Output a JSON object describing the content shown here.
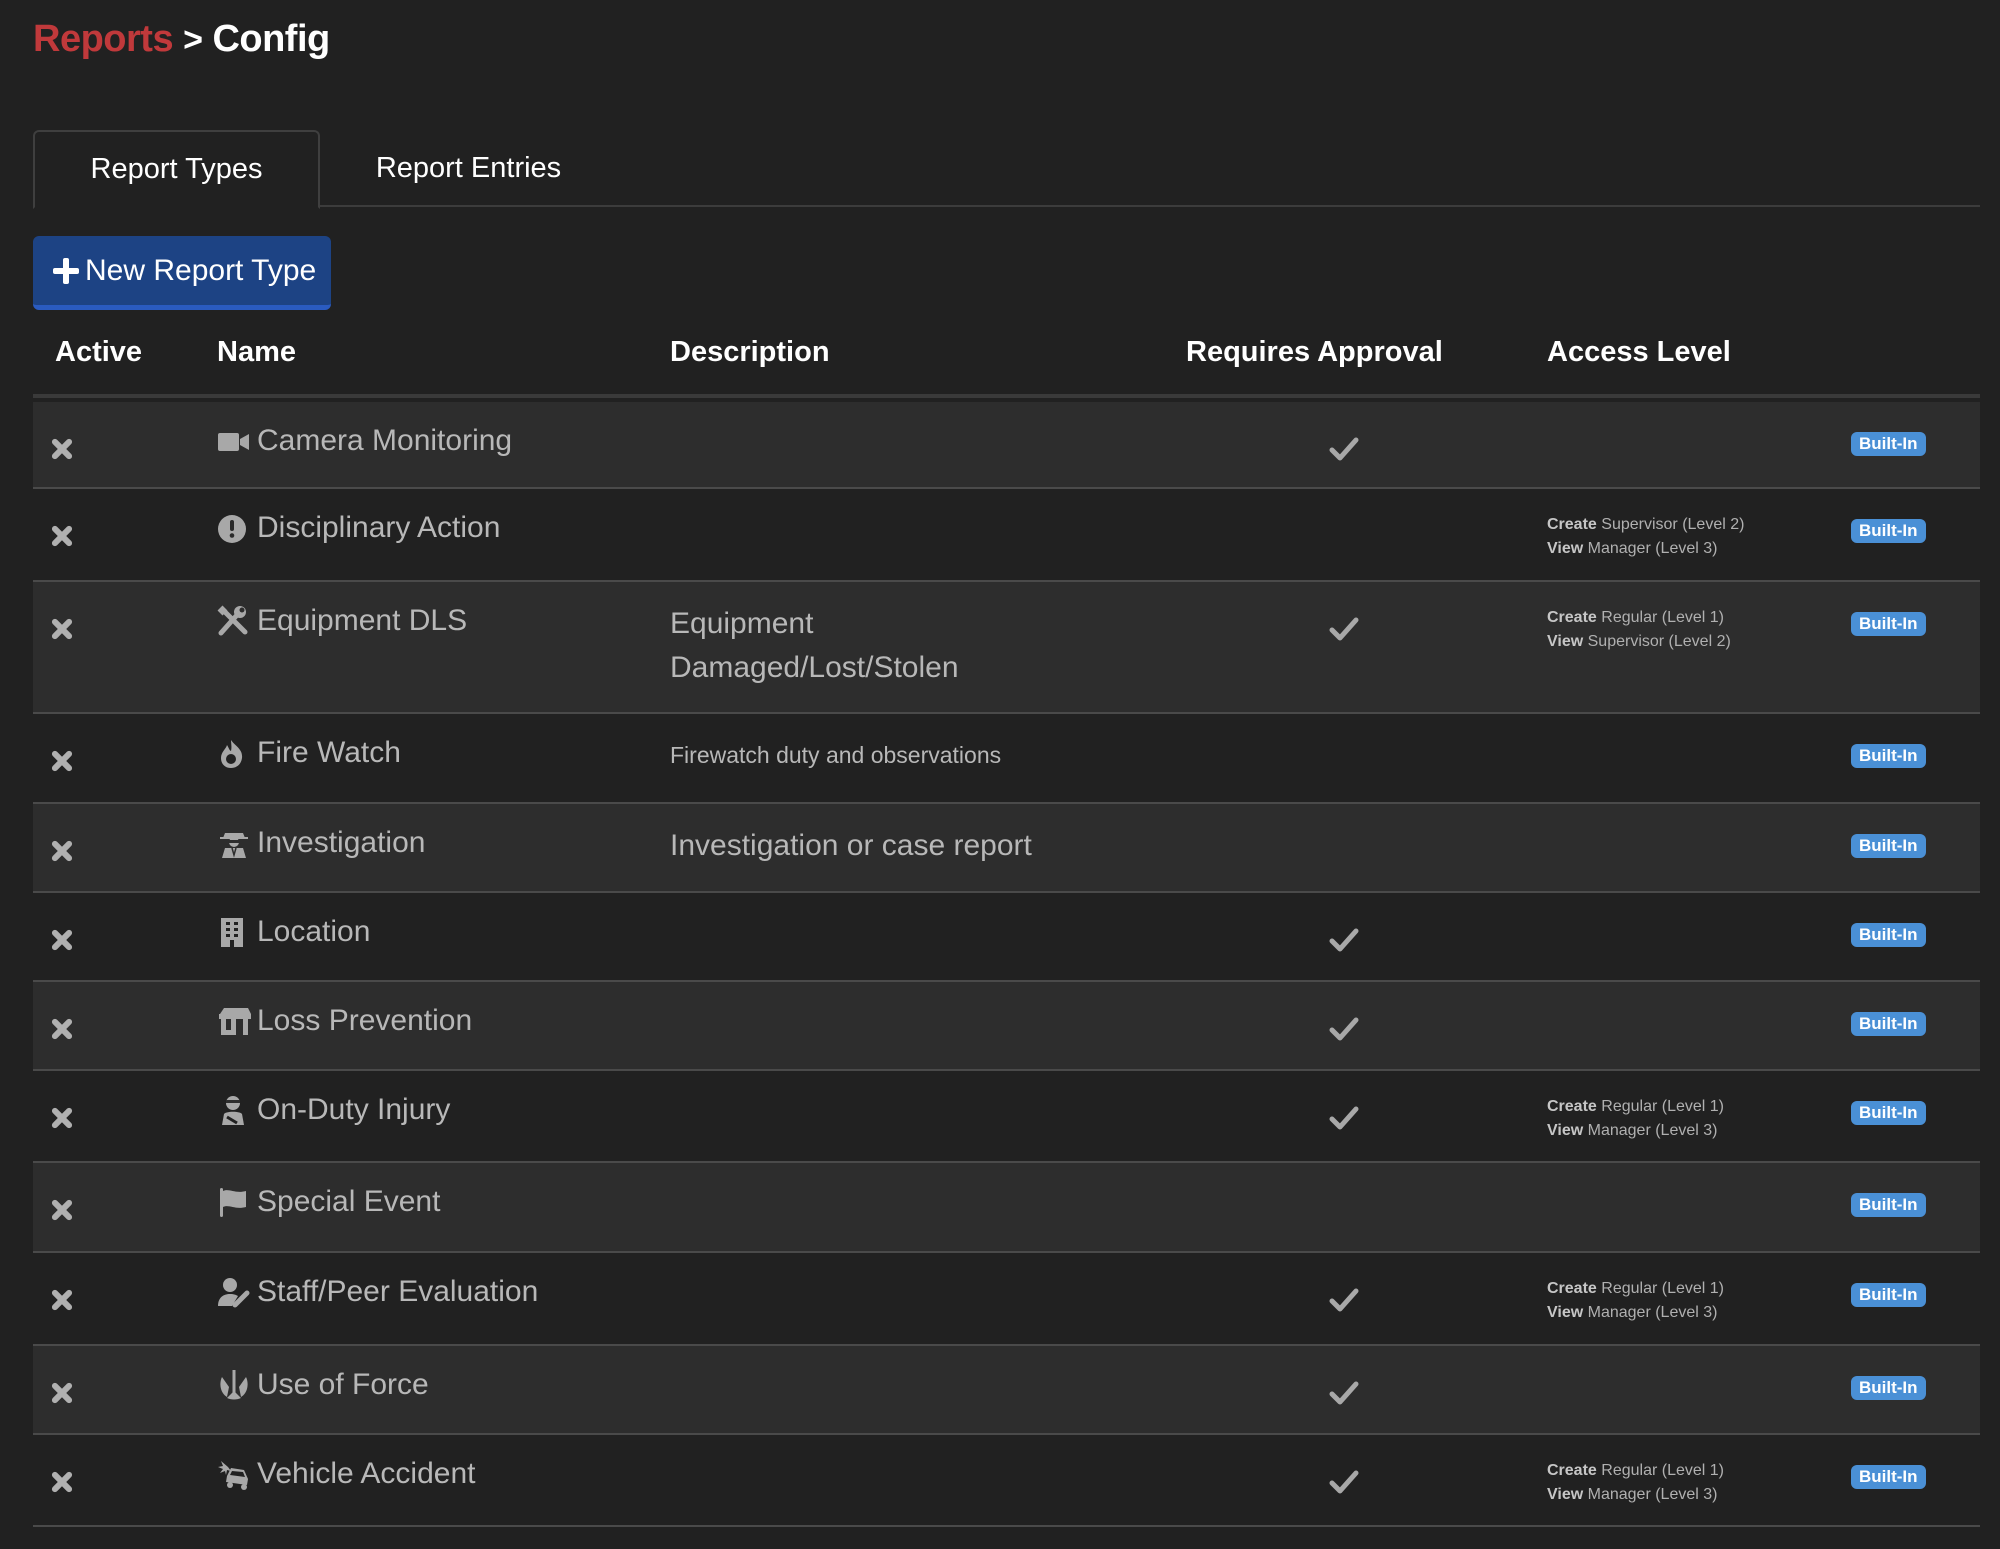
{
  "breadcrumb": {
    "parent": "Reports",
    "separator": ">",
    "current": "Config"
  },
  "tabs": [
    {
      "label": "Report Types",
      "active": true
    },
    {
      "label": "Report Entries",
      "active": false
    }
  ],
  "toolbar": {
    "new_button_label": "New Report Type",
    "new_button_icon": "plus-icon"
  },
  "table": {
    "columns": [
      "Active",
      "Name",
      "Description",
      "Requires Approval",
      "Access Level"
    ],
    "rows": [
      {
        "active": false,
        "icon": "video-camera-icon",
        "name": "Camera Monitoring",
        "description": "",
        "requires_approval": true,
        "access": null,
        "badge": "Built-In"
      },
      {
        "active": false,
        "icon": "exclamation-circle-icon",
        "name": "Disciplinary Action",
        "description": "",
        "requires_approval": false,
        "access": {
          "create_label": "Create",
          "create_value": "Supervisor (Level 2)",
          "view_label": "View",
          "view_value": "Manager (Level 3)"
        },
        "badge": "Built-In"
      },
      {
        "active": false,
        "icon": "tools-icon",
        "name": "Equipment DLS",
        "description": "Equipment Damaged/Lost/Stolen",
        "requires_approval": true,
        "access": {
          "create_label": "Create",
          "create_value": "Regular (Level 1)",
          "view_label": "View",
          "view_value": "Supervisor (Level 2)"
        },
        "badge": "Built-In"
      },
      {
        "active": false,
        "icon": "fire-icon",
        "name": "Fire Watch",
        "description": "Firewatch duty and observations",
        "requires_approval": false,
        "access": null,
        "badge": "Built-In"
      },
      {
        "active": false,
        "icon": "detective-icon",
        "name": "Investigation",
        "description": "Investigation or case report",
        "requires_approval": false,
        "access": null,
        "badge": "Built-In"
      },
      {
        "active": false,
        "icon": "building-icon",
        "name": "Location",
        "description": "",
        "requires_approval": true,
        "access": null,
        "badge": "Built-In"
      },
      {
        "active": false,
        "icon": "store-icon",
        "name": "Loss Prevention",
        "description": "",
        "requires_approval": true,
        "access": null,
        "badge": "Built-In"
      },
      {
        "active": false,
        "icon": "injured-person-icon",
        "name": "On-Duty Injury",
        "description": "",
        "requires_approval": true,
        "access": {
          "create_label": "Create",
          "create_value": "Regular (Level 1)",
          "view_label": "View",
          "view_value": "Manager (Level 3)"
        },
        "badge": "Built-In"
      },
      {
        "active": false,
        "icon": "flag-icon",
        "name": "Special Event",
        "description": "",
        "requires_approval": false,
        "access": null,
        "badge": "Built-In"
      },
      {
        "active": false,
        "icon": "user-edit-icon",
        "name": "Staff/Peer Evaluation",
        "description": "",
        "requires_approval": true,
        "access": {
          "create_label": "Create",
          "create_value": "Regular (Level 1)",
          "view_label": "View",
          "view_value": "Manager (Level 3)"
        },
        "badge": "Built-In"
      },
      {
        "active": false,
        "icon": "force-emblem-icon",
        "name": "Use of Force",
        "description": "",
        "requires_approval": true,
        "access": null,
        "badge": "Built-In"
      },
      {
        "active": false,
        "icon": "car-crash-icon",
        "name": "Vehicle Accident",
        "description": "",
        "requires_approval": true,
        "access": {
          "create_label": "Create",
          "create_value": "Regular (Level 1)",
          "view_label": "View",
          "view_value": "Manager (Level 3)"
        },
        "badge": "Built-In"
      }
    ]
  },
  "colors": {
    "background": "#212121",
    "row_alt": "#2d2d2d",
    "breadcrumb_link": "#c0393b",
    "primary_button": "#1d4384",
    "badge": "#4a90d6",
    "muted_text": "#b8b8b8"
  }
}
